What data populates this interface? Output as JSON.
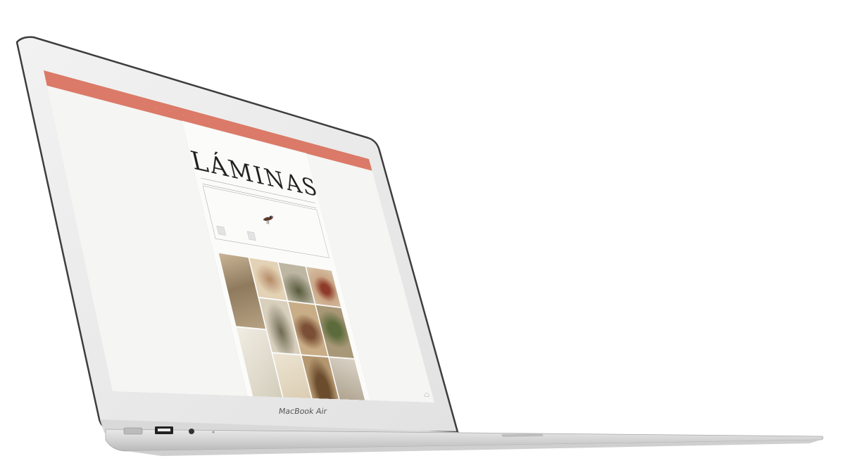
{
  "laptop": {
    "model_label": "MacBook Air"
  },
  "screen": {
    "accent": "#db7a68",
    "nav_items": [
      "·",
      "·",
      "·",
      "·",
      "·",
      "·",
      "·"
    ],
    "masthead": "LÁMINAS",
    "meta_left": "",
    "meta_right": "",
    "intro_left": "",
    "intro_right": "",
    "buttons": [
      "",
      ""
    ],
    "sub_note": "",
    "icons": [
      "bird-icon",
      "home-icon"
    ]
  }
}
